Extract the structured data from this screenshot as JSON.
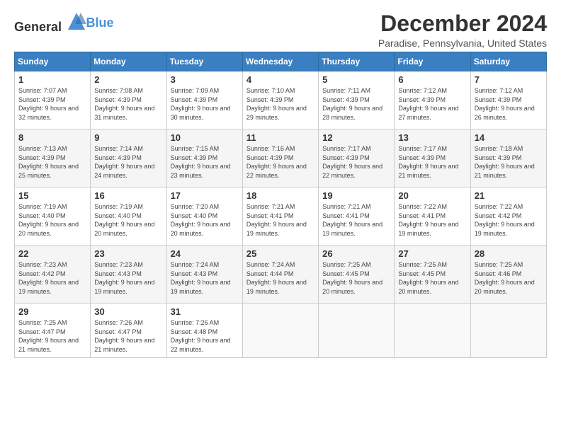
{
  "logo": {
    "general": "General",
    "blue": "Blue"
  },
  "title": "December 2024",
  "location": "Paradise, Pennsylvania, United States",
  "days_header": [
    "Sunday",
    "Monday",
    "Tuesday",
    "Wednesday",
    "Thursday",
    "Friday",
    "Saturday"
  ],
  "weeks": [
    [
      {
        "day": "1",
        "sunrise": "7:07 AM",
        "sunset": "4:39 PM",
        "daylight": "9 hours and 32 minutes."
      },
      {
        "day": "2",
        "sunrise": "7:08 AM",
        "sunset": "4:39 PM",
        "daylight": "9 hours and 31 minutes."
      },
      {
        "day": "3",
        "sunrise": "7:09 AM",
        "sunset": "4:39 PM",
        "daylight": "9 hours and 30 minutes."
      },
      {
        "day": "4",
        "sunrise": "7:10 AM",
        "sunset": "4:39 PM",
        "daylight": "9 hours and 29 minutes."
      },
      {
        "day": "5",
        "sunrise": "7:11 AM",
        "sunset": "4:39 PM",
        "daylight": "9 hours and 28 minutes."
      },
      {
        "day": "6",
        "sunrise": "7:12 AM",
        "sunset": "4:39 PM",
        "daylight": "9 hours and 27 minutes."
      },
      {
        "day": "7",
        "sunrise": "7:12 AM",
        "sunset": "4:39 PM",
        "daylight": "9 hours and 26 minutes."
      }
    ],
    [
      {
        "day": "8",
        "sunrise": "7:13 AM",
        "sunset": "4:39 PM",
        "daylight": "9 hours and 25 minutes."
      },
      {
        "day": "9",
        "sunrise": "7:14 AM",
        "sunset": "4:39 PM",
        "daylight": "9 hours and 24 minutes."
      },
      {
        "day": "10",
        "sunrise": "7:15 AM",
        "sunset": "4:39 PM",
        "daylight": "9 hours and 23 minutes."
      },
      {
        "day": "11",
        "sunrise": "7:16 AM",
        "sunset": "4:39 PM",
        "daylight": "9 hours and 22 minutes."
      },
      {
        "day": "12",
        "sunrise": "7:17 AM",
        "sunset": "4:39 PM",
        "daylight": "9 hours and 22 minutes."
      },
      {
        "day": "13",
        "sunrise": "7:17 AM",
        "sunset": "4:39 PM",
        "daylight": "9 hours and 21 minutes."
      },
      {
        "day": "14",
        "sunrise": "7:18 AM",
        "sunset": "4:39 PM",
        "daylight": "9 hours and 21 minutes."
      }
    ],
    [
      {
        "day": "15",
        "sunrise": "7:19 AM",
        "sunset": "4:40 PM",
        "daylight": "9 hours and 20 minutes."
      },
      {
        "day": "16",
        "sunrise": "7:19 AM",
        "sunset": "4:40 PM",
        "daylight": "9 hours and 20 minutes."
      },
      {
        "day": "17",
        "sunrise": "7:20 AM",
        "sunset": "4:40 PM",
        "daylight": "9 hours and 20 minutes."
      },
      {
        "day": "18",
        "sunrise": "7:21 AM",
        "sunset": "4:41 PM",
        "daylight": "9 hours and 19 minutes."
      },
      {
        "day": "19",
        "sunrise": "7:21 AM",
        "sunset": "4:41 PM",
        "daylight": "9 hours and 19 minutes."
      },
      {
        "day": "20",
        "sunrise": "7:22 AM",
        "sunset": "4:41 PM",
        "daylight": "9 hours and 19 minutes."
      },
      {
        "day": "21",
        "sunrise": "7:22 AM",
        "sunset": "4:42 PM",
        "daylight": "9 hours and 19 minutes."
      }
    ],
    [
      {
        "day": "22",
        "sunrise": "7:23 AM",
        "sunset": "4:42 PM",
        "daylight": "9 hours and 19 minutes."
      },
      {
        "day": "23",
        "sunrise": "7:23 AM",
        "sunset": "4:43 PM",
        "daylight": "9 hours and 19 minutes."
      },
      {
        "day": "24",
        "sunrise": "7:24 AM",
        "sunset": "4:43 PM",
        "daylight": "9 hours and 19 minutes."
      },
      {
        "day": "25",
        "sunrise": "7:24 AM",
        "sunset": "4:44 PM",
        "daylight": "9 hours and 19 minutes."
      },
      {
        "day": "26",
        "sunrise": "7:25 AM",
        "sunset": "4:45 PM",
        "daylight": "9 hours and 20 minutes."
      },
      {
        "day": "27",
        "sunrise": "7:25 AM",
        "sunset": "4:45 PM",
        "daylight": "9 hours and 20 minutes."
      },
      {
        "day": "28",
        "sunrise": "7:25 AM",
        "sunset": "4:46 PM",
        "daylight": "9 hours and 20 minutes."
      }
    ],
    [
      {
        "day": "29",
        "sunrise": "7:25 AM",
        "sunset": "4:47 PM",
        "daylight": "9 hours and 21 minutes."
      },
      {
        "day": "30",
        "sunrise": "7:26 AM",
        "sunset": "4:47 PM",
        "daylight": "9 hours and 21 minutes."
      },
      {
        "day": "31",
        "sunrise": "7:26 AM",
        "sunset": "4:48 PM",
        "daylight": "9 hours and 22 minutes."
      },
      null,
      null,
      null,
      null
    ]
  ]
}
